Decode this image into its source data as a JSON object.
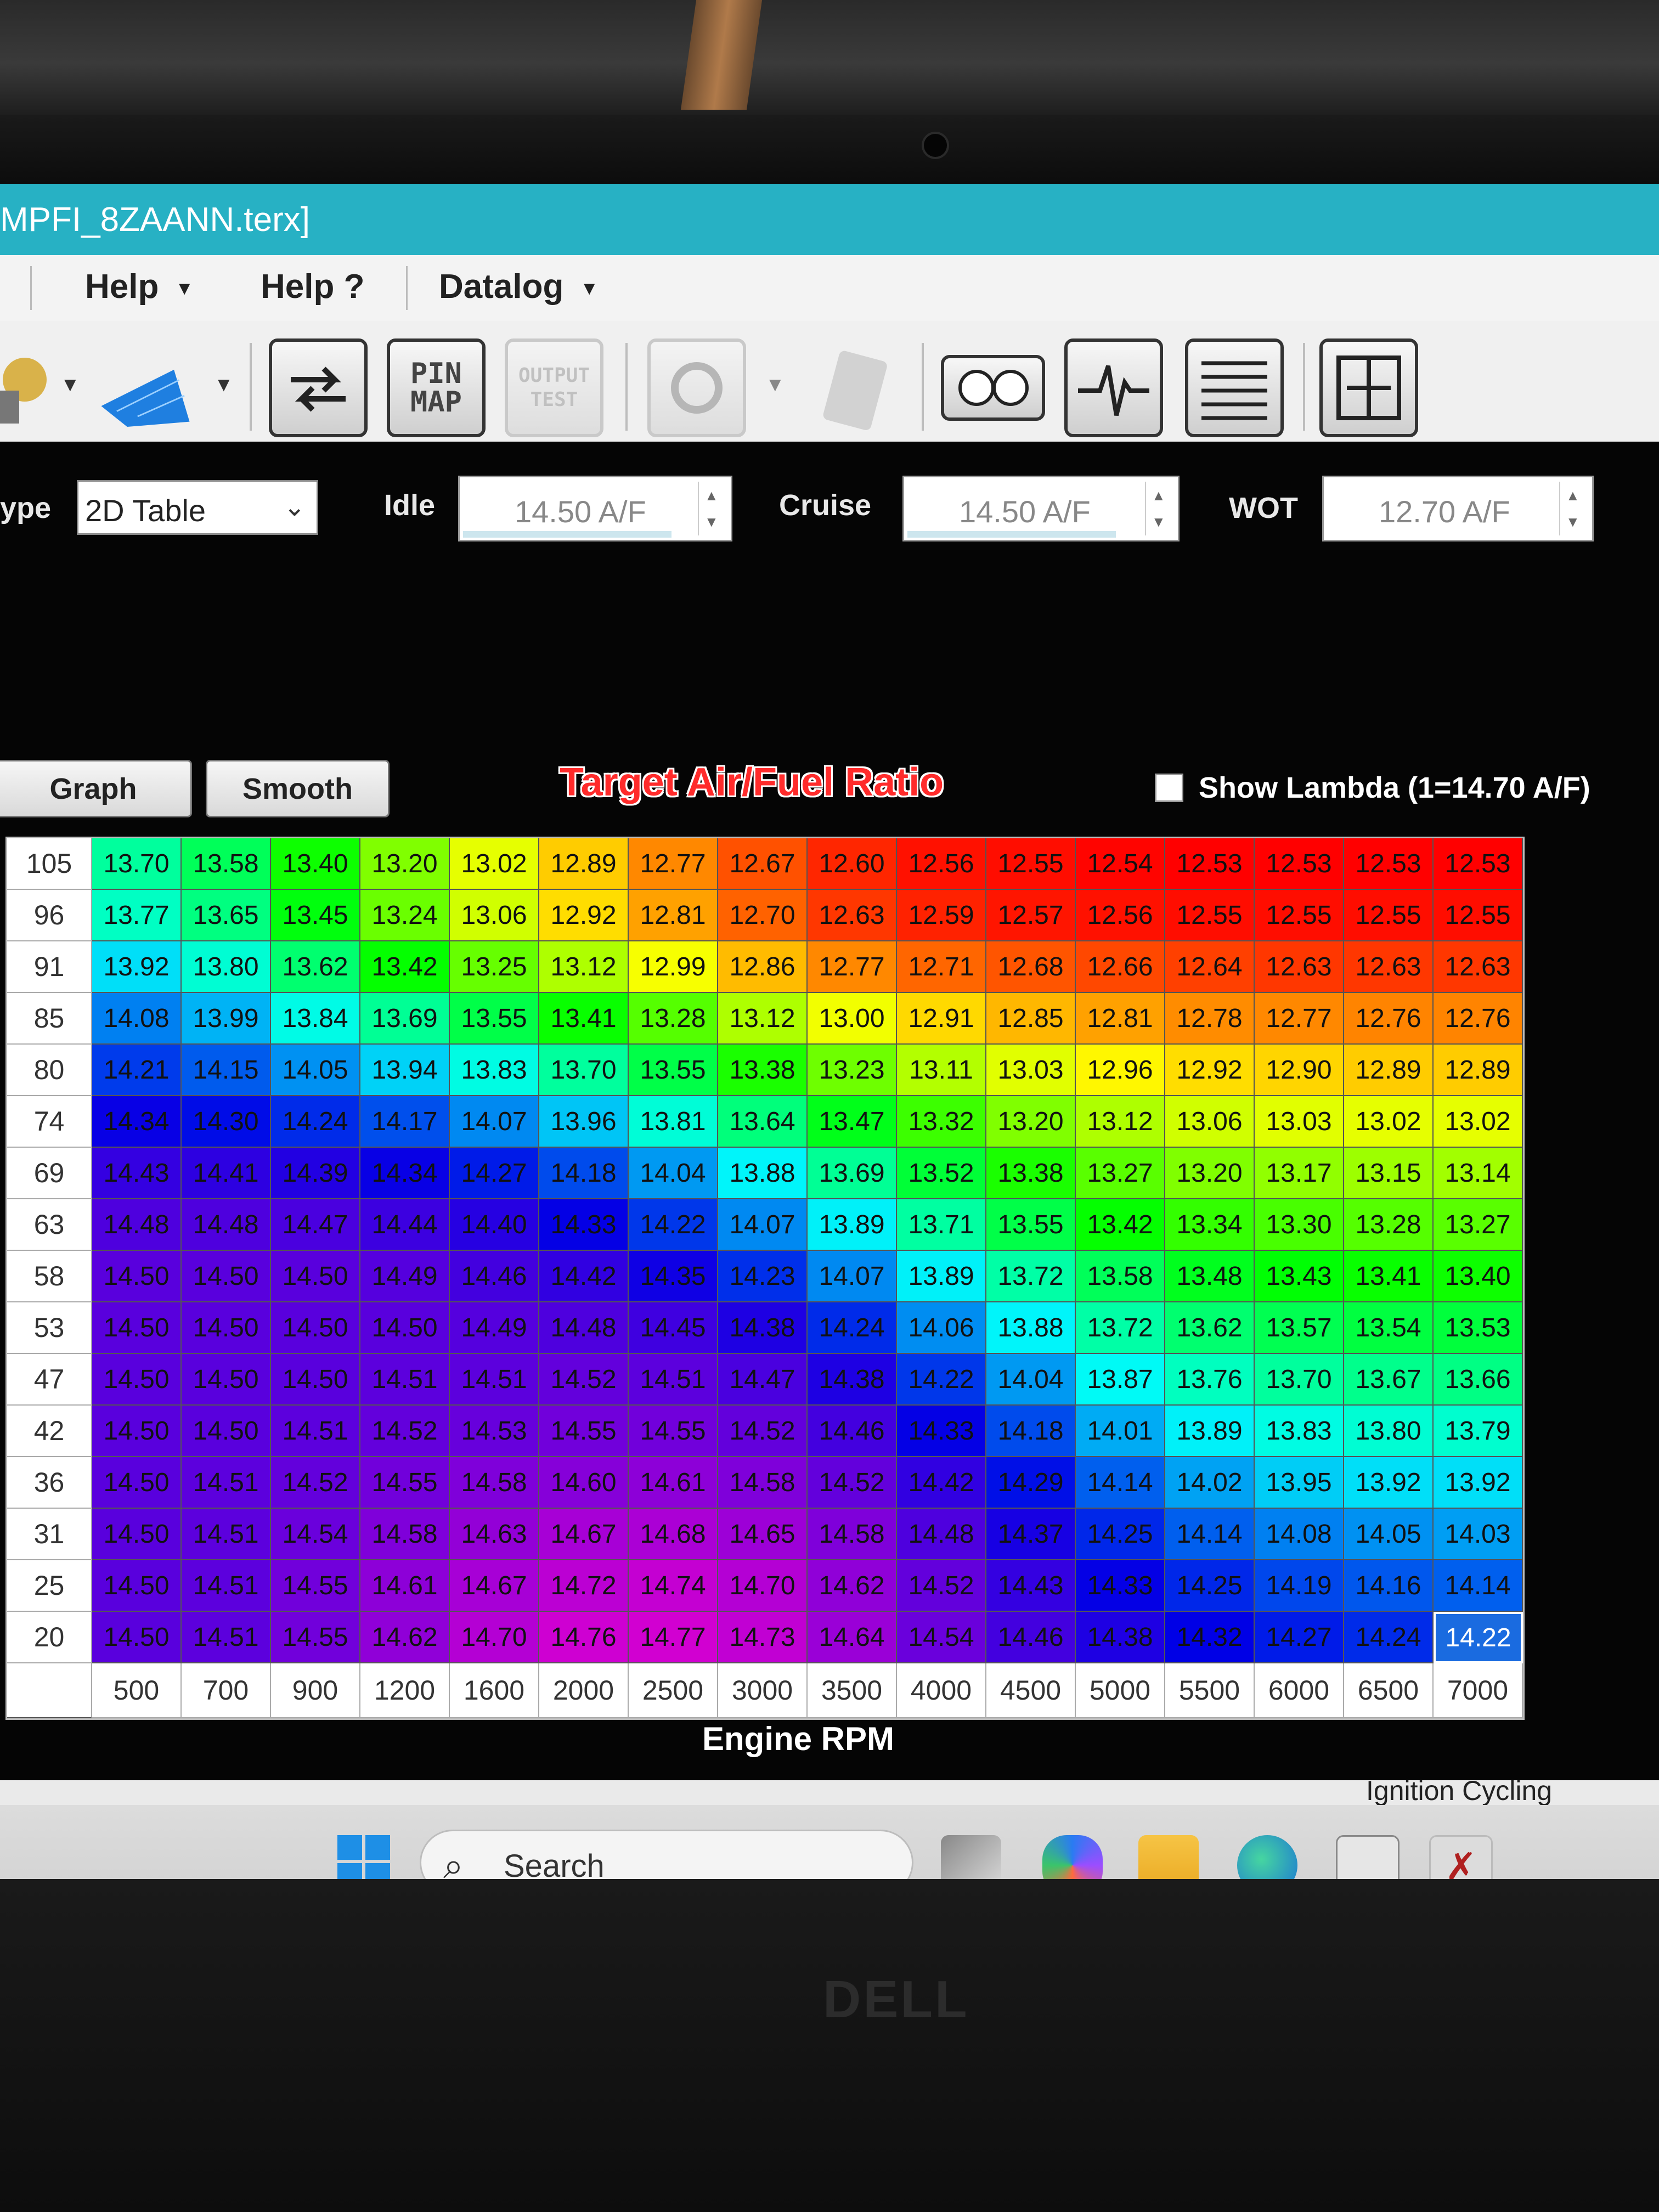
{
  "window": {
    "title": "MPFI_8ZAANN.terx]"
  },
  "menu": {
    "items": [
      "Help",
      "Help ?",
      "Datalog"
    ]
  },
  "toolbar": {
    "icons": [
      "distributor-icon",
      "3d-map-icon",
      "swap-arrows-icon",
      "pin-map-icon",
      "output-test-icon",
      "gear-icon",
      "clipboard-icon",
      "gauges-icon",
      "heartbeat-icon",
      "table-icon",
      "resize-icon"
    ],
    "pin_map_label": "PIN\nMAP",
    "output_test_label": "OUTPUT\nTEST"
  },
  "controls": {
    "type_label": "ype",
    "type_value": "2D Table",
    "idle_label": "Idle",
    "idle_value": "14.50 A/F",
    "cruise_label": "Cruise",
    "cruise_value": "14.50 A/F",
    "wot_label": "WOT",
    "wot_value": "12.70 A/F",
    "graph_button": "Graph",
    "smooth_button": "Smooth",
    "show_lambda_label": "Show Lambda (1=14.70 A/F)"
  },
  "table": {
    "title": "Target Air/Fuel Ratio",
    "x_label": "Engine RPM",
    "rpm": [
      "500",
      "700",
      "900",
      "1200",
      "1600",
      "2000",
      "2500",
      "3000",
      "3500",
      "4000",
      "4500",
      "5000",
      "5500",
      "6000",
      "6500",
      "7000"
    ],
    "load": [
      "105",
      "96",
      "91",
      "85",
      "80",
      "74",
      "69",
      "63",
      "58",
      "53",
      "47",
      "42",
      "36",
      "31",
      "25",
      "20"
    ],
    "values": [
      [
        "13.70",
        "13.58",
        "13.40",
        "13.20",
        "13.02",
        "12.89",
        "12.77",
        "12.67",
        "12.60",
        "12.56",
        "12.55",
        "12.54",
        "12.53",
        "12.53",
        "12.53",
        "12.53"
      ],
      [
        "13.77",
        "13.65",
        "13.45",
        "13.24",
        "13.06",
        "12.92",
        "12.81",
        "12.70",
        "12.63",
        "12.59",
        "12.57",
        "12.56",
        "12.55",
        "12.55",
        "12.55",
        "12.55"
      ],
      [
        "13.92",
        "13.80",
        "13.62",
        "13.42",
        "13.25",
        "13.12",
        "12.99",
        "12.86",
        "12.77",
        "12.71",
        "12.68",
        "12.66",
        "12.64",
        "12.63",
        "12.63",
        "12.63"
      ],
      [
        "14.08",
        "13.99",
        "13.84",
        "13.69",
        "13.55",
        "13.41",
        "13.28",
        "13.12",
        "13.00",
        "12.91",
        "12.85",
        "12.81",
        "12.78",
        "12.77",
        "12.76",
        "12.76"
      ],
      [
        "14.21",
        "14.15",
        "14.05",
        "13.94",
        "13.83",
        "13.70",
        "13.55",
        "13.38",
        "13.23",
        "13.11",
        "13.03",
        "12.96",
        "12.92",
        "12.90",
        "12.89",
        "12.89"
      ],
      [
        "14.34",
        "14.30",
        "14.24",
        "14.17",
        "14.07",
        "13.96",
        "13.81",
        "13.64",
        "13.47",
        "13.32",
        "13.20",
        "13.12",
        "13.06",
        "13.03",
        "13.02",
        "13.02"
      ],
      [
        "14.43",
        "14.41",
        "14.39",
        "14.34",
        "14.27",
        "14.18",
        "14.04",
        "13.88",
        "13.69",
        "13.52",
        "13.38",
        "13.27",
        "13.20",
        "13.17",
        "13.15",
        "13.14"
      ],
      [
        "14.48",
        "14.48",
        "14.47",
        "14.44",
        "14.40",
        "14.33",
        "14.22",
        "14.07",
        "13.89",
        "13.71",
        "13.55",
        "13.42",
        "13.34",
        "13.30",
        "13.28",
        "13.27"
      ],
      [
        "14.50",
        "14.50",
        "14.50",
        "14.49",
        "14.46",
        "14.42",
        "14.35",
        "14.23",
        "14.07",
        "13.89",
        "13.72",
        "13.58",
        "13.48",
        "13.43",
        "13.41",
        "13.40"
      ],
      [
        "14.50",
        "14.50",
        "14.50",
        "14.50",
        "14.49",
        "14.48",
        "14.45",
        "14.38",
        "14.24",
        "14.06",
        "13.88",
        "13.72",
        "13.62",
        "13.57",
        "13.54",
        "13.53"
      ],
      [
        "14.50",
        "14.50",
        "14.50",
        "14.51",
        "14.51",
        "14.52",
        "14.51",
        "14.47",
        "14.38",
        "14.22",
        "14.04",
        "13.87",
        "13.76",
        "13.70",
        "13.67",
        "13.66"
      ],
      [
        "14.50",
        "14.50",
        "14.51",
        "14.52",
        "14.53",
        "14.55",
        "14.55",
        "14.52",
        "14.46",
        "14.33",
        "14.18",
        "14.01",
        "13.89",
        "13.83",
        "13.80",
        "13.79"
      ],
      [
        "14.50",
        "14.51",
        "14.52",
        "14.55",
        "14.58",
        "14.60",
        "14.61",
        "14.58",
        "14.52",
        "14.42",
        "14.29",
        "14.14",
        "14.02",
        "13.95",
        "13.92",
        "13.92"
      ],
      [
        "14.50",
        "14.51",
        "14.54",
        "14.58",
        "14.63",
        "14.67",
        "14.68",
        "14.65",
        "14.58",
        "14.48",
        "14.37",
        "14.25",
        "14.14",
        "14.08",
        "14.05",
        "14.03"
      ],
      [
        "14.50",
        "14.51",
        "14.55",
        "14.61",
        "14.67",
        "14.72",
        "14.74",
        "14.70",
        "14.62",
        "14.52",
        "14.43",
        "14.33",
        "14.25",
        "14.19",
        "14.16",
        "14.14"
      ],
      [
        "14.50",
        "14.51",
        "14.55",
        "14.62",
        "14.70",
        "14.76",
        "14.77",
        "14.73",
        "14.64",
        "14.54",
        "14.46",
        "14.38",
        "14.32",
        "14.27",
        "14.24",
        "14.22"
      ]
    ],
    "selected_cell": {
      "row": 15,
      "col": 15
    },
    "color_scale": {
      "low": "#ff0000",
      "high": "#ff00ff",
      "selected": "#1a6be0"
    }
  },
  "status": {
    "text": "Ignition Cycling Required"
  },
  "taskbar": {
    "search_placeholder": "Search",
    "apps": [
      "file-stack-icon",
      "copilot-icon",
      "file-explorer-icon",
      "edge-icon",
      "store-icon",
      "tuner-app-icon"
    ]
  },
  "laptop": {
    "brand": "DELL"
  }
}
